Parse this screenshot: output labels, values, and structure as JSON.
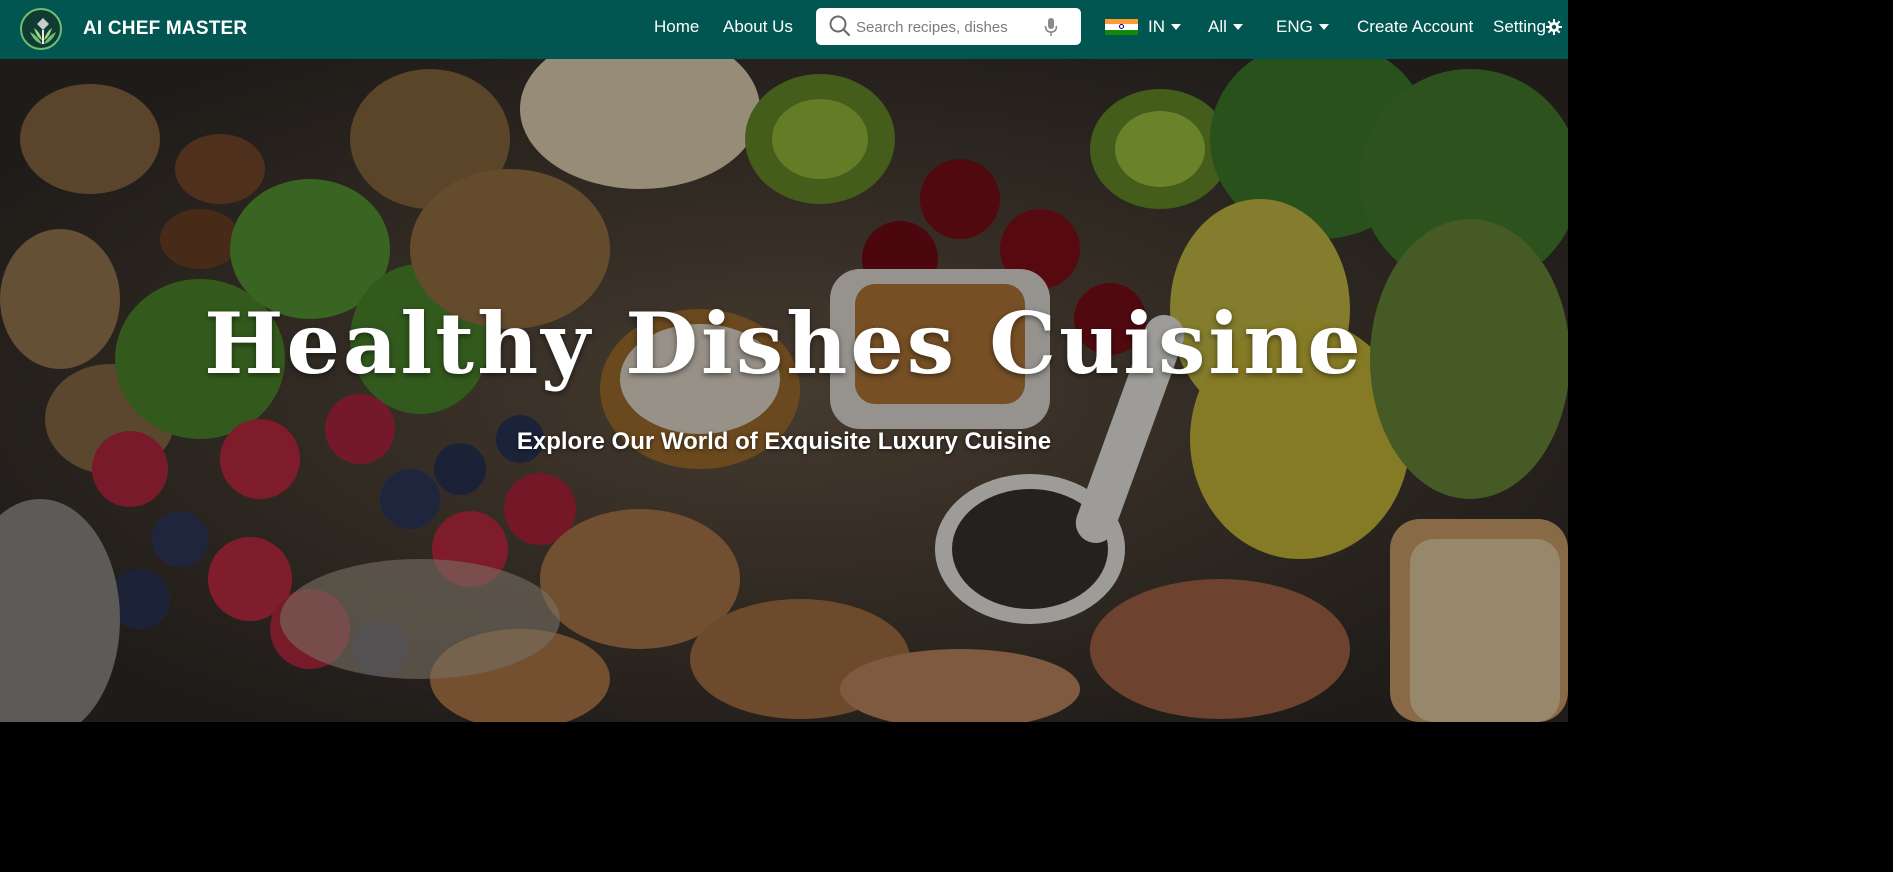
{
  "navbar": {
    "brand_name": "AI CHEF MASTER",
    "links": {
      "home": "Home",
      "about": "About Us",
      "create_account": "Create Account",
      "settings": "Setting"
    },
    "search": {
      "placeholder": "Search recipes, dishes",
      "value": ""
    },
    "country": {
      "selected": "IN",
      "flag": "india-flag"
    },
    "category": {
      "selected": "All"
    },
    "language": {
      "selected": "ENG"
    },
    "colors": {
      "background": "#015651",
      "text": "#ffffff"
    }
  },
  "hero": {
    "title": "Healthy Dishes Cuisine",
    "subtitle": "Explore Our World of Exquisite Luxury Cuisine",
    "background": "food-ingredients-photo"
  },
  "icons": {
    "logo": "leaf-logo-icon",
    "search": "search-icon",
    "mic": "mic-icon",
    "caret": "caret-down-icon",
    "settings": "gear-icon"
  }
}
